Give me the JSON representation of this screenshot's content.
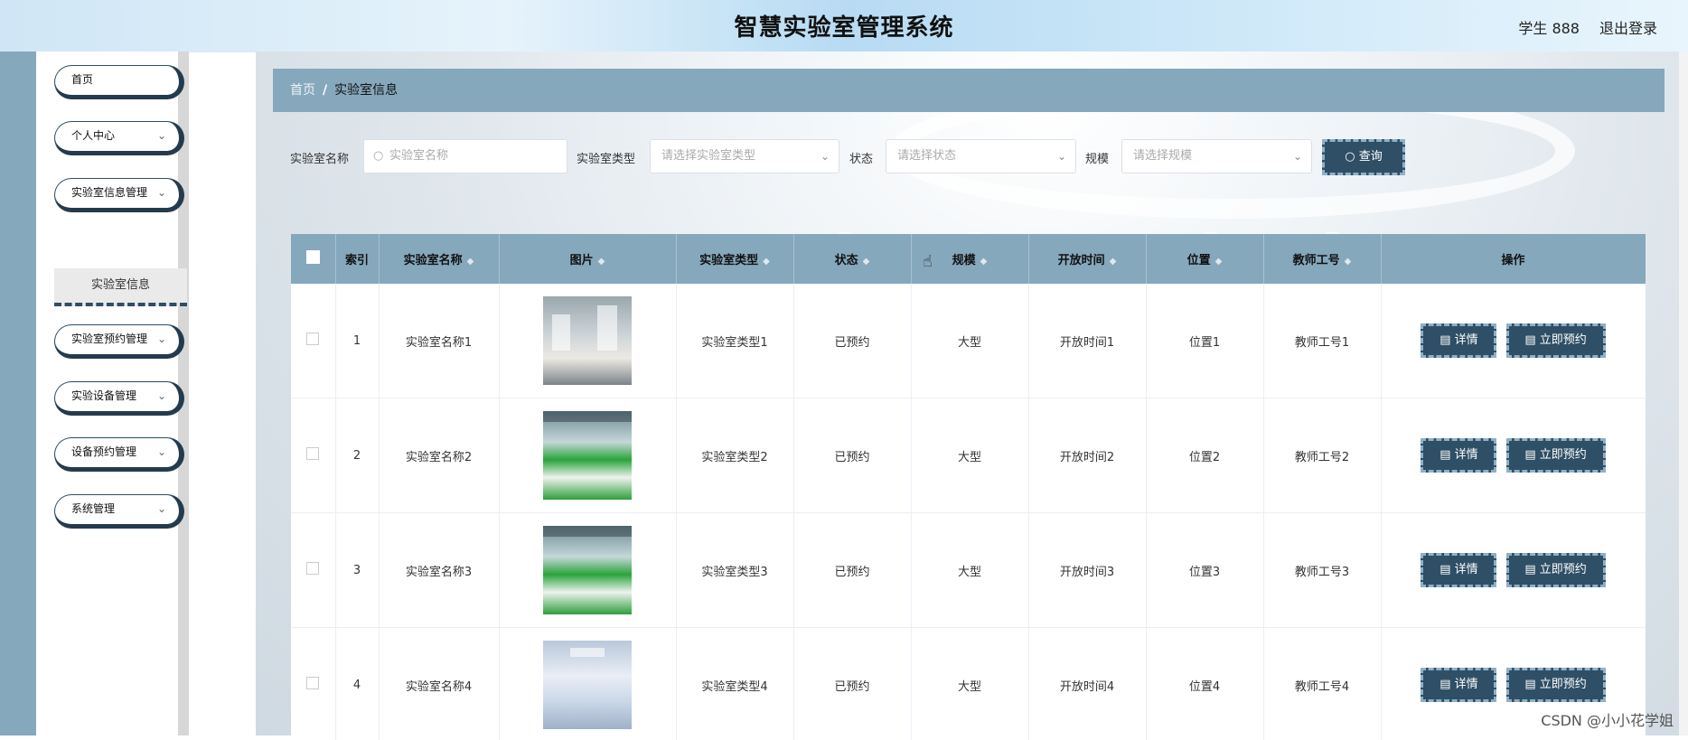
{
  "header": {
    "title": "智慧实验室管理系统",
    "user": "学生 888",
    "logout": "退出登录"
  },
  "sidebar": {
    "items": [
      {
        "label": "首页",
        "chevron": ""
      },
      {
        "label": "个人中心",
        "chevron": "⌄"
      },
      {
        "label": "实验室信息管理",
        "chevron": "⌄"
      },
      {
        "label": "实验室预约管理",
        "chevron": "⌄"
      },
      {
        "label": "实验设备管理",
        "chevron": "⌄"
      },
      {
        "label": "设备预约管理",
        "chevron": "⌄"
      },
      {
        "label": "系统管理",
        "chevron": "⌄"
      }
    ],
    "active_sub": "实验室信息"
  },
  "breadcrumb": {
    "home": "首页",
    "separator": "/",
    "current": "实验室信息"
  },
  "search": {
    "name_label": "实验室名称",
    "name_placeholder": "实验室名称",
    "type_label": "实验室类型",
    "type_placeholder": "请选择实验室类型",
    "status_label": "状态",
    "status_placeholder": "请选择状态",
    "scale_label": "规模",
    "scale_placeholder": "请选择规模",
    "query_label": "查询"
  },
  "table": {
    "headers": [
      "索引",
      "实验室名称",
      "图片",
      "实验室类型",
      "状态",
      "规模",
      "开放时间",
      "位置",
      "教师工号",
      "操作"
    ],
    "rows": [
      {
        "index": "1",
        "name": "实验室名称1",
        "type": "实验室类型1",
        "status": "已预约",
        "scale": "大型",
        "open": "开放时间1",
        "location": "位置1",
        "teacher": "教师工号1"
      },
      {
        "index": "2",
        "name": "实验室名称2",
        "type": "实验室类型2",
        "status": "已预约",
        "scale": "大型",
        "open": "开放时间2",
        "location": "位置2",
        "teacher": "教师工号2"
      },
      {
        "index": "3",
        "name": "实验室名称3",
        "type": "实验室类型3",
        "status": "已预约",
        "scale": "大型",
        "open": "开放时间3",
        "location": "位置3",
        "teacher": "教师工号3"
      },
      {
        "index": "4",
        "name": "实验室名称4",
        "type": "实验室类型4",
        "status": "已预约",
        "scale": "大型",
        "open": "开放时间4",
        "location": "位置4",
        "teacher": "教师工号4"
      }
    ],
    "detail_label": "详情",
    "book_label": "立即预约"
  },
  "watermark": "CSDN @小小花学姐",
  "colors": {
    "accent": "#86a8bd",
    "button": "#2f4f66"
  }
}
